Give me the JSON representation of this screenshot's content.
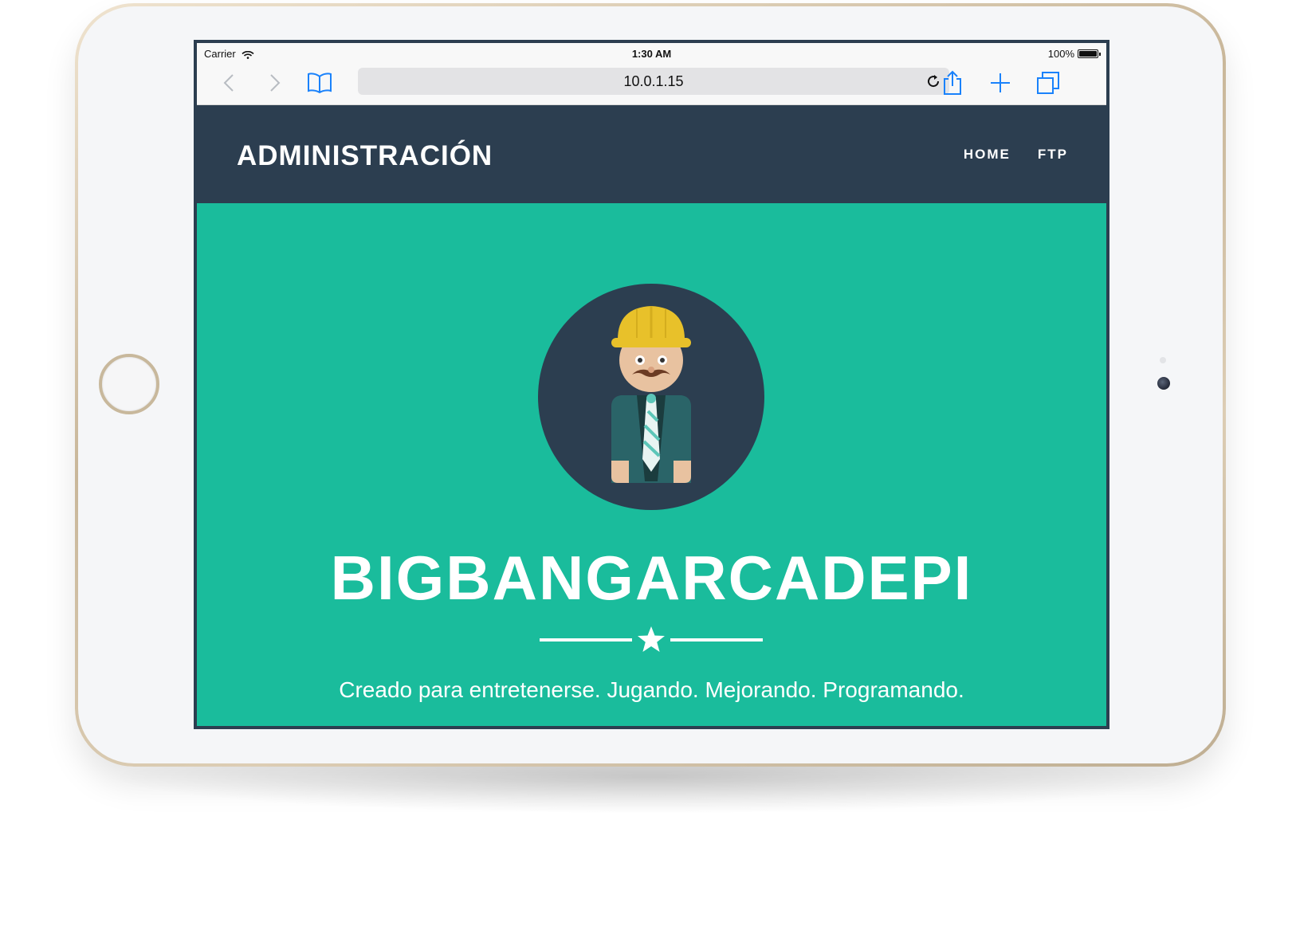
{
  "status_bar": {
    "carrier": "Carrier",
    "time": "1:30 AM",
    "battery": "100%"
  },
  "browser": {
    "url": "10.0.1.15",
    "icons": [
      "back-icon",
      "forward-icon",
      "bookmarks-icon",
      "reload-icon",
      "share-icon",
      "new-tab-icon",
      "tabs-icon"
    ]
  },
  "navbar": {
    "brand": "ADMINISTRACIÓN",
    "links": [
      "HOME",
      "FTP"
    ]
  },
  "hero": {
    "title": "BIGBANGARCADEPI",
    "tagline": "Creado para entretenerse. Jugando. Mejorando. Programando."
  },
  "colors": {
    "navbar_bg": "#2c3e50",
    "hero_bg": "#1abc9c",
    "text": "#ffffff",
    "browser_accent": "#1a82fb"
  }
}
